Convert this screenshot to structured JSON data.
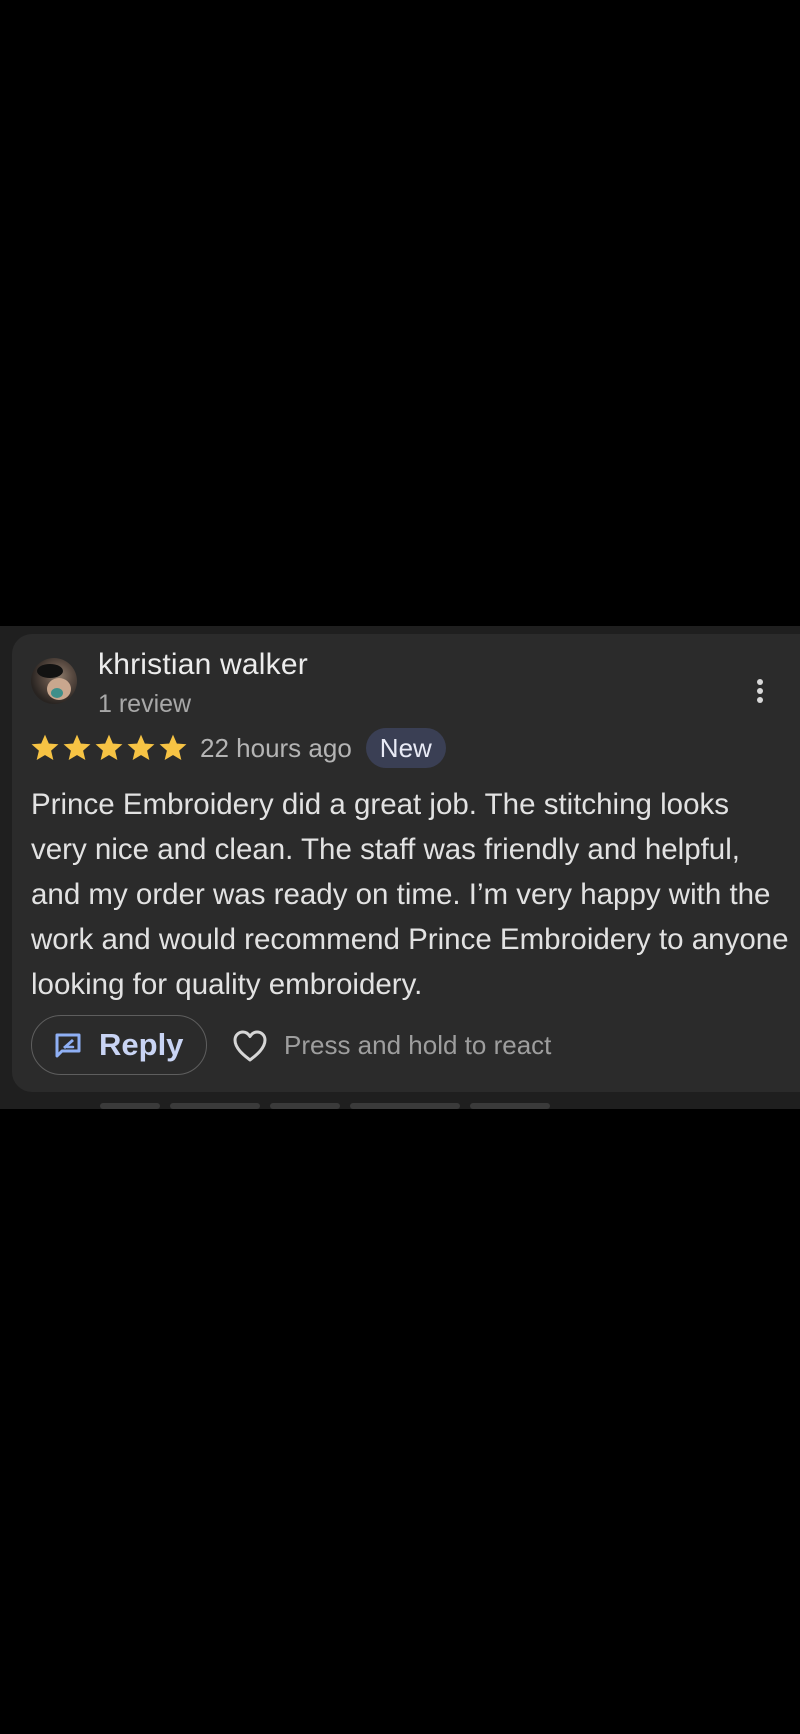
{
  "review": {
    "reviewer_name": "khristian walker",
    "review_count": "1 review",
    "rating": 5,
    "rating_max": 5,
    "time_ago": "22 hours ago",
    "badge": "New",
    "text": "Prince Embroidery did a great job. The stitching looks very nice and clean. The staff was friendly and helpful, and my order was ready on time. I’m very happy with the work and would recommend Prince Embroidery to anyone looking for quality embroidery.",
    "reply_label": "Reply",
    "react_hint": "Press and hold to react"
  },
  "icons": {
    "avatar": "profile-photo",
    "more": "more-vert-icon",
    "star": "star-icon",
    "reply": "reply-edit-icon",
    "heart": "heart-outline-icon"
  },
  "colors": {
    "page_background": "#000000",
    "card_background": "#2b2b2b",
    "star": "#f6c344",
    "accent": "#c9d4f4",
    "badge_background": "#3a3f54"
  }
}
